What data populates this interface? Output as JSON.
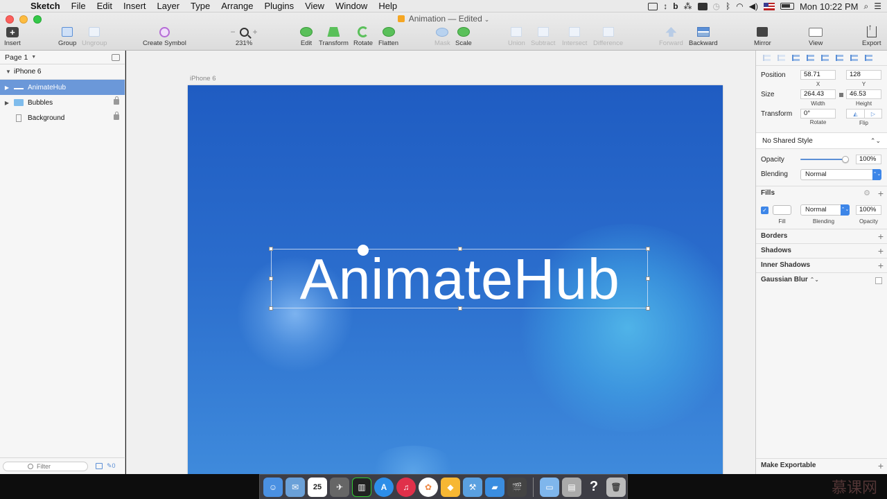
{
  "menubar": {
    "app_name": "Sketch",
    "items": [
      "File",
      "Edit",
      "Insert",
      "Layer",
      "Type",
      "Arrange",
      "Plugins",
      "View",
      "Window",
      "Help"
    ],
    "clock": "Mon 10:22 PM"
  },
  "window": {
    "doc_title": "Animation",
    "doc_status": "— Edited"
  },
  "toolbar": {
    "insert": "Insert",
    "group": "Group",
    "ungroup": "Ungroup",
    "create_symbol": "Create Symbol",
    "zoom_level": "231%",
    "zoom_minus": "−",
    "zoom_plus": "+",
    "edit": "Edit",
    "transform": "Transform",
    "rotate": "Rotate",
    "flatten": "Flatten",
    "mask": "Mask",
    "scale": "Scale",
    "union": "Union",
    "subtract": "Subtract",
    "intersect": "Intersect",
    "difference": "Difference",
    "forward": "Forward",
    "backward": "Backward",
    "mirror": "Mirror",
    "view": "View",
    "export": "Export"
  },
  "layers_panel": {
    "page_label": "Page 1",
    "artboard_name": "iPhone 6",
    "layers": [
      {
        "name": "AnimateHub",
        "selected": true,
        "icon": "text-layer-icon"
      },
      {
        "name": "Bubbles",
        "locked": true,
        "icon": "folder-icon"
      },
      {
        "name": "Background",
        "locked": true,
        "icon": "rectangle-icon"
      }
    ],
    "filter_placeholder": "Filter",
    "slice_count": "0"
  },
  "canvas": {
    "artboard_label": "iPhone 6",
    "headline_text": "AnimateHub",
    "colors": {
      "artboard_top": "#1f5cc2",
      "artboard_bottom": "#3f8bdc"
    }
  },
  "inspector": {
    "position_label": "Position",
    "position_x": "58.71",
    "position_y": "128",
    "x_label": "X",
    "y_label": "Y",
    "size_label": "Size",
    "width": "264.43",
    "height": "46.53",
    "width_label": "Width",
    "height_label": "Height",
    "transform_label": "Transform",
    "rotate_value": "0°",
    "rotate_label": "Rotate",
    "flip_label": "Flip",
    "shared_style": "No Shared Style",
    "opacity_label": "Opacity",
    "opacity_value": "100%",
    "opacity_fraction": 1.0,
    "blending_label": "Blending",
    "blending_value": "Normal",
    "fills_label": "Fills",
    "fill_blending": "Normal",
    "fill_opacity": "100%",
    "fill_label": "Fill",
    "fill_blending_label": "Blending",
    "fill_opacity_label": "Opacity",
    "fill_color": "#ffffff",
    "borders_label": "Borders",
    "shadows_label": "Shadows",
    "inner_shadows_label": "Inner Shadows",
    "gaussian_blur_label": "Gaussian Blur",
    "make_exportable": "Make Exportable"
  },
  "dock": {
    "apps": [
      "finder-icon",
      "mail-icon",
      "calendar-icon",
      "launchpad-icon",
      "activity-monitor-icon",
      "app-store-icon",
      "itunes-icon",
      "photos-icon",
      "sketch-icon",
      "xcode-icon",
      "keynote-icon",
      "final-cut-icon"
    ],
    "calendar_day": "25"
  },
  "watermark_text": "慕课网"
}
